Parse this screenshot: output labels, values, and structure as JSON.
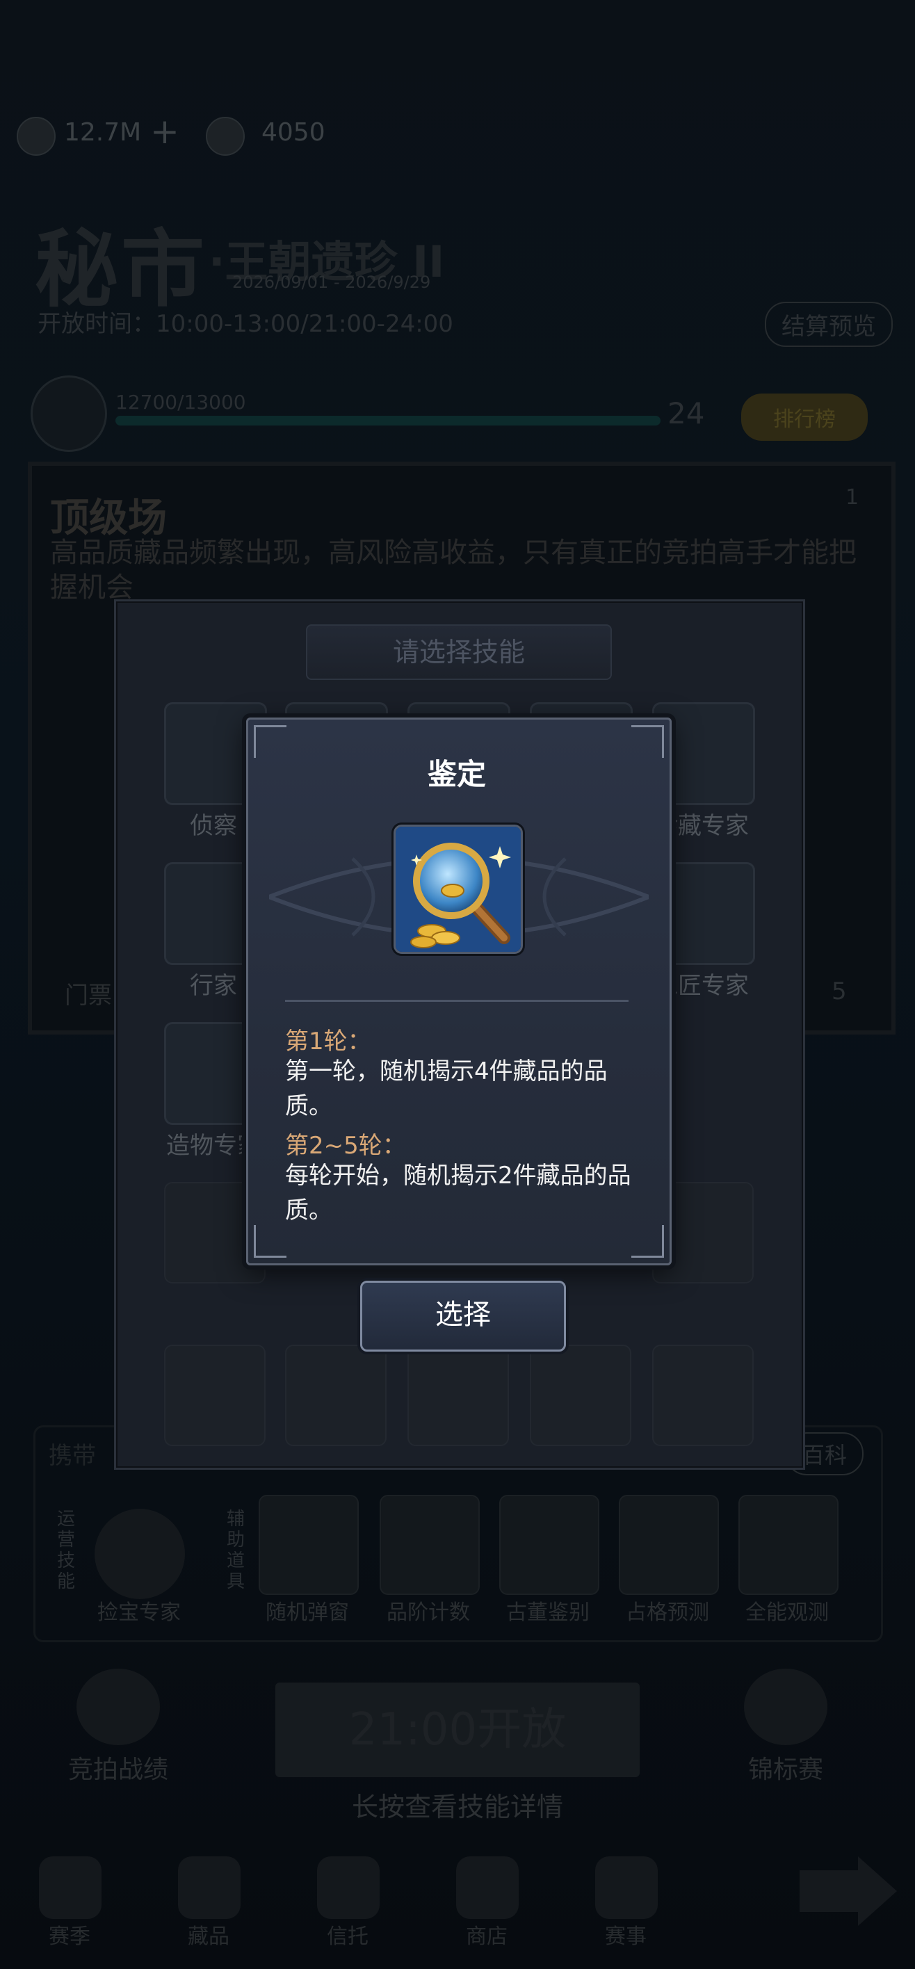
{
  "background": {
    "currency": {
      "coins": "12.7M",
      "gems": "4050"
    },
    "title": "秘市",
    "subtitle": "·王朝遗珍 II",
    "date_range": "2026/09/01 - 2026/9/29",
    "open_time": "开放时间：10:00-13:00/21:00-24:00",
    "settlement_preview": "结算预览",
    "progress_text": "12700/13000",
    "level": "24",
    "rank_button": "排行榜",
    "venue": {
      "name": "顶级场",
      "description": "高品质藏品频繁出现，高风险高收益，只有真正的竞拍高手才能把握机会",
      "ticket_label": "门票",
      "corner_number": "1",
      "side_number": "5"
    },
    "carry_label": "携带",
    "encyclopedia": "百科",
    "bottom_skills": [
      "捡宝专家",
      "随机弹窗",
      "品阶计数",
      "古董鉴别",
      "占格预测",
      "全能观测"
    ],
    "bottom_side_labels": [
      "运营技能",
      "辅助道具"
    ],
    "auction_list": "竞拍战绩",
    "championship": "锦标赛",
    "open_button": "21:00开放",
    "hint": "长按查看技能详情",
    "nav": [
      "赛季",
      "藏品",
      "信托",
      "商店",
      "赛事"
    ]
  },
  "skill_panel": {
    "header": "请选择技能",
    "skills_row1": [
      "侦察",
      "",
      "",
      "",
      "珍藏专家"
    ],
    "skills_row2": [
      "行家",
      "",
      "",
      "",
      "工匠专家"
    ],
    "skills_row3": [
      "造物专家"
    ]
  },
  "popup": {
    "title": "鉴定",
    "icon": "magnifier-coins-icon",
    "rounds": [
      {
        "label": "第1轮：",
        "desc": "第一轮，随机揭示4件藏品的品质。"
      },
      {
        "label": "第2~5轮：",
        "desc": "每轮开始，随机揭示2件藏品的品质。"
      }
    ],
    "select_button": "选择"
  },
  "colors": {
    "accent_orange": "#d9a876",
    "popup_bg": "#2c3446",
    "button_border": "#7f8aa0"
  }
}
